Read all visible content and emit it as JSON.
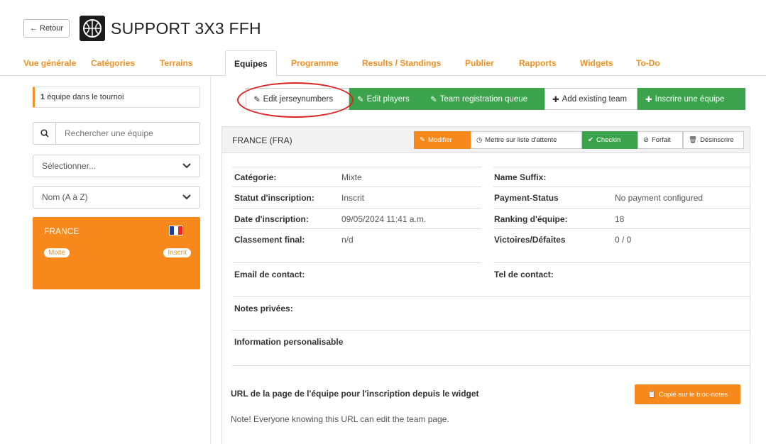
{
  "header": {
    "back_label": "Retour",
    "title": "SUPPORT 3X3 FFH"
  },
  "tabs": [
    {
      "label": "Vue générale"
    },
    {
      "label": "Catégories"
    },
    {
      "label": "Terrains"
    },
    {
      "label": "Equipes",
      "active": true
    },
    {
      "label": "Programme"
    },
    {
      "label": "Results / Standings"
    },
    {
      "label": "Publier"
    },
    {
      "label": "Rapports"
    },
    {
      "label": "Widgets"
    },
    {
      "label": "To-Do"
    }
  ],
  "sidebar": {
    "count_number": "1",
    "count_text": "équipe dans le tournoi",
    "search_placeholder": "Rechercher une équipe",
    "select_category": "Sélectionner...",
    "select_sort": "Nom (A à Z)",
    "team": {
      "name": "FRANCE",
      "category_badge": "Mixte",
      "status_badge": "Inscrit"
    }
  },
  "actions": [
    {
      "label": "Edit jerseynumbers",
      "style": "white",
      "icon": "edit-icon"
    },
    {
      "label": "Edit players",
      "style": "green",
      "icon": "edit-icon"
    },
    {
      "label": "Team registration queue",
      "style": "green",
      "icon": "edit-icon"
    },
    {
      "label": "Add existing team",
      "style": "white",
      "icon": "plus-circle-icon"
    },
    {
      "label": "Inscrire une équipe",
      "style": "green",
      "icon": "plus-circle-icon"
    }
  ],
  "panel": {
    "title": "FRANCE (FRA)",
    "buttons": {
      "modifier": "Modifier",
      "waitlist": "Mettre sur liste d'attente",
      "checkin": "Checkin",
      "forfait": "Forfait",
      "desinscrire": "Désinscrire"
    },
    "fields": {
      "categorie_label": "Catégorie:",
      "categorie_value": "Mixte",
      "statut_label": "Statut d'inscription:",
      "statut_value": "Inscrit",
      "date_label": "Date d'inscription:",
      "date_value": "09/05/2024 11:41 a.m.",
      "classement_label": "Classement final:",
      "classement_value": "n/d",
      "suffix_label": "Name Suffix:",
      "payment_label": "Payment-Status",
      "payment_value": "No payment configured",
      "ranking_label": "Ranking d'équipe:",
      "ranking_value": "18",
      "victoires_label": "Victoires/Défaites",
      "victoires_value": "0 / 0",
      "email_label": "Email de contact:",
      "tel_label": "Tel de contact:",
      "notes_label": "Notes privées:",
      "info_label": "Information personalisable"
    },
    "url_label": "URL de la page de l'équipe pour l'inscription depuis le widget",
    "copy_button": "Copié sur le bloc-notes",
    "url_note": "Note! Everyone knowing this URL can edit the team page."
  },
  "colors": {
    "accent": "#f7891c",
    "green": "#3aa34b",
    "annotation": "#dd2222"
  }
}
